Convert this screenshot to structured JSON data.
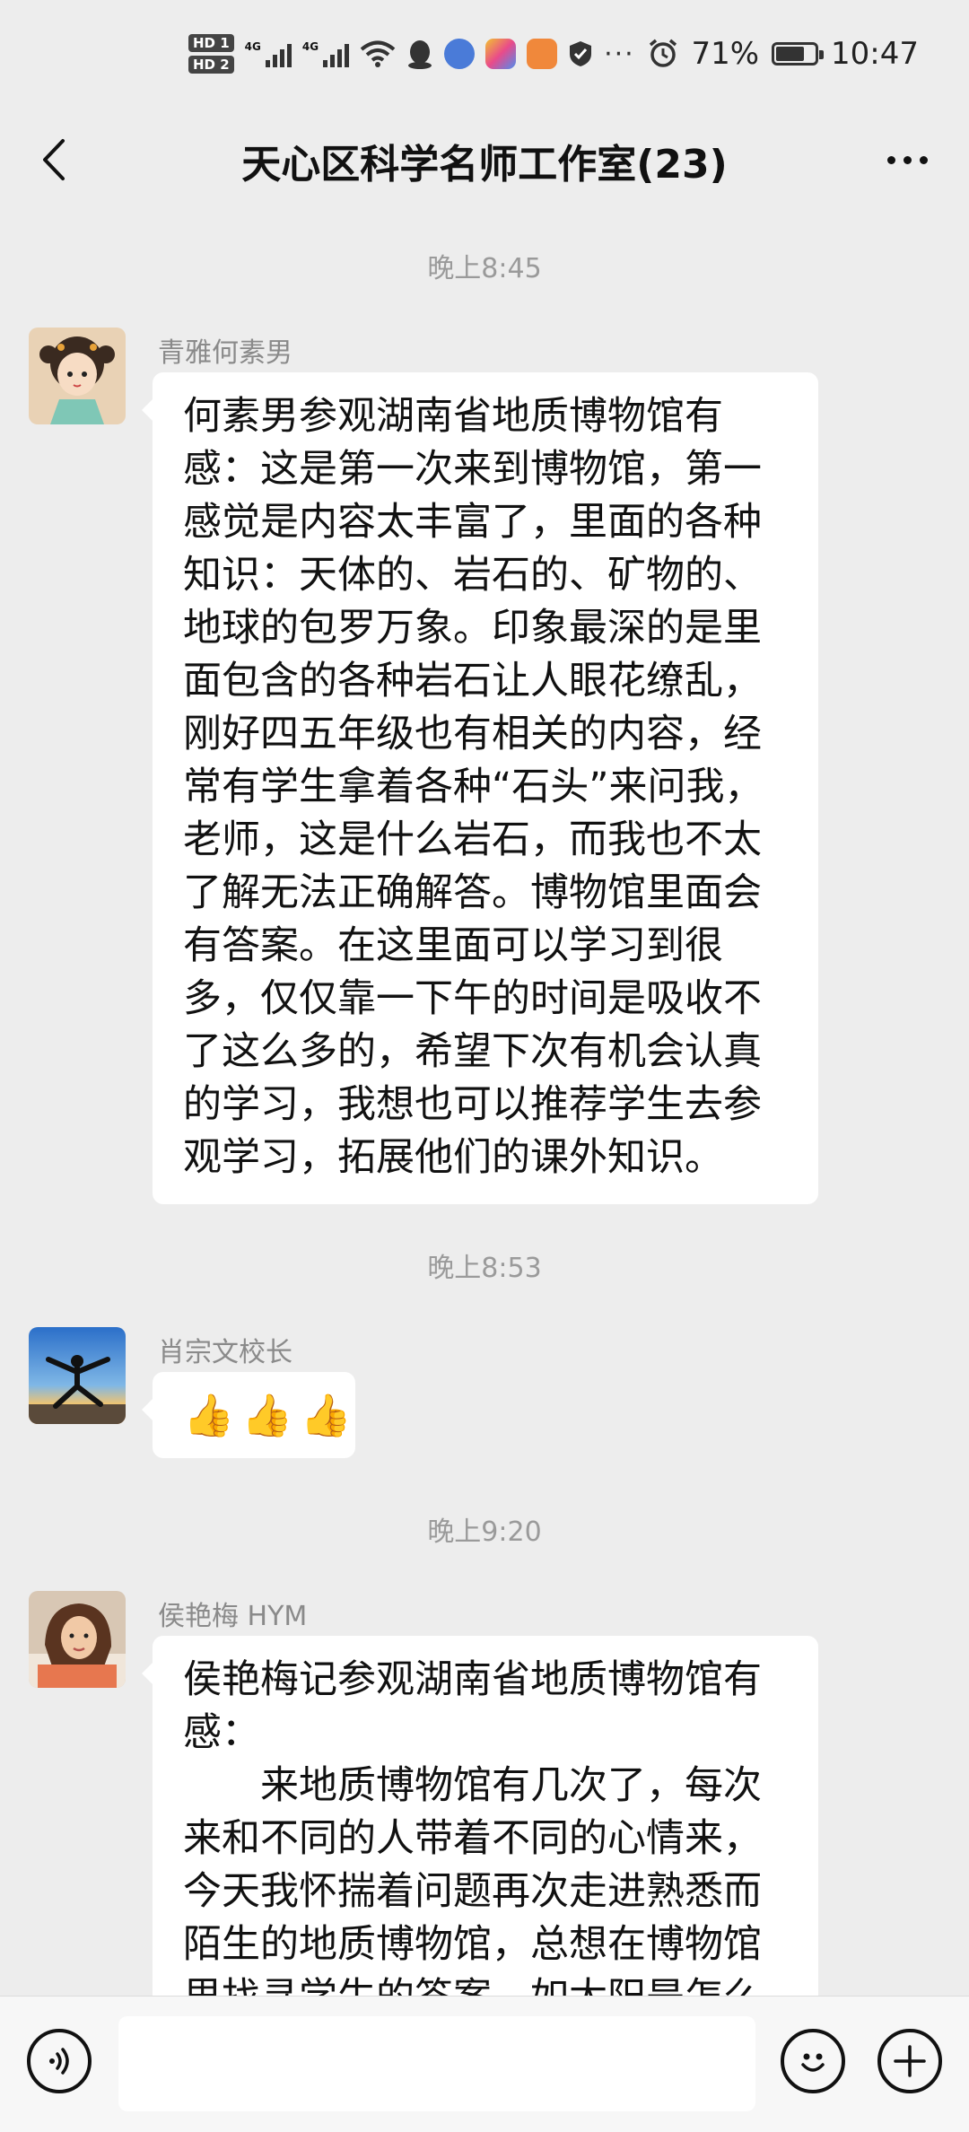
{
  "status_bar": {
    "hd1": "HD 1",
    "hd2": "HD 2",
    "net1": "4G",
    "net2": "4G",
    "more": "···",
    "battery_text": "71%",
    "battery_level": 0.71,
    "time": "10:47",
    "icons": [
      "wifi-icon",
      "qq-icon",
      "music-icon",
      "app-icon",
      "health-icon",
      "shield-icon",
      "alarm-icon",
      "battery-icon"
    ]
  },
  "nav": {
    "title": "天心区科学名师工作室(23)"
  },
  "messages": [
    {
      "time": "晚上8:45",
      "sender": "青雅何素男",
      "paragraphs": [
        "何素男参观湖南省地质博物馆有感：这是第一次来到博物馆，第一感觉是内容太丰富了，里面的各种知识：天体的、岩石的、矿物的、地球的包罗万象。印象最深的是里面包含的各种岩石让人眼花缭乱，刚好四五年级也有相关的内容，经常有学生拿着各种“石头”来问我，老师，这是什么岩石，而我也不太了解无法正确解答。博物馆里面会有答案。在这里面可以学习到很多，仅仅靠一下午的时间是吸收不了这么多的，希望下次有机会认真的学习，我想也可以推荐学生去参观学习，拓展他们的课外知识。"
      ]
    },
    {
      "time": "晚上8:53",
      "sender": "肖宗文校长",
      "emoji": [
        "👍",
        "👍",
        "👍"
      ]
    },
    {
      "time": "晚上9:20",
      "sender": "侯艳梅 HYM",
      "paragraphs": [
        "侯艳梅记参观湖南省地质博物馆有感：",
        "来地质博物馆有几次了，每次来和不同的人带着不同的心情来，今天我怀揣着问题再次走进熟悉而陌生的地质博物馆，总想在博物馆里找寻学生的答案，如太阳是怎么"
      ]
    }
  ],
  "bottom_bar": {
    "input_value": ""
  },
  "colors": {
    "background": "#ededed",
    "bubble": "#ffffff",
    "time_text": "#9a9a9a",
    "sender_text": "#8a8a8a"
  }
}
